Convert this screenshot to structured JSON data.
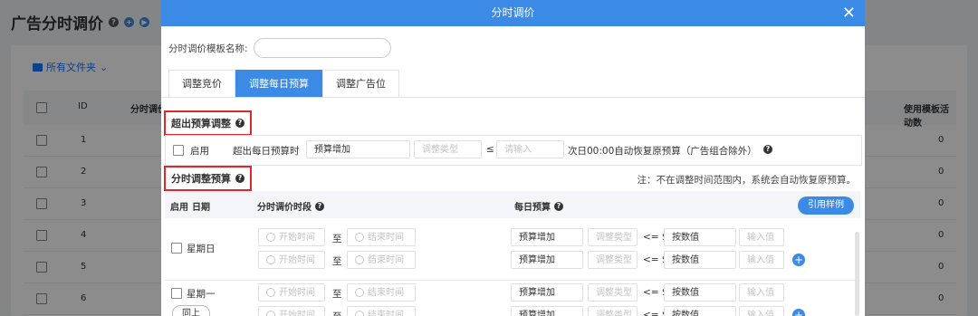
{
  "background": {
    "page_title": "广告分时调价",
    "folder_label": "所有文件夹",
    "columns": {
      "id": "ID",
      "name": "分时调价模",
      "campaigns": "使用模板活动数"
    },
    "rows": [
      {
        "id": "1",
        "count": "0"
      },
      {
        "id": "2",
        "count": "0"
      },
      {
        "id": "3",
        "count": "0"
      },
      {
        "id": "4",
        "count": "0"
      },
      {
        "id": "5",
        "count": "0"
      },
      {
        "id": "6",
        "count": "0"
      }
    ]
  },
  "modal": {
    "title": "分时调价",
    "name_label": "分时调价模板名称:",
    "tabs": [
      "调整竞价",
      "调整每日预算",
      "调整广告位"
    ],
    "active_tab": "调整每日预算",
    "section1": {
      "title": "超出预算调整",
      "enable_label": "启用",
      "when_label": "超出每日预算时",
      "adjust_select": "预算增加",
      "adjust_type_ph": "调整类型",
      "le_sign": "≤",
      "amount_ph": "请输入",
      "restore_text": "次日00:00自动恢复原预算（广告组合除外）"
    },
    "section2": {
      "title": "分时调整预算",
      "note": "注：不在调整时间范围内，系统会自动恢复原预算。",
      "col_enable": "启用",
      "col_date": "日期",
      "col_period": "分时调价时段",
      "col_budget": "每日预算",
      "example_button": "引用样例",
      "start_ph": "开始时间",
      "end_ph": "结束时间",
      "to_label": "至",
      "budget_select": "预算增加",
      "type_ph": "调整类型",
      "le_text": "<= $",
      "value_select": "按数值",
      "value_ph": "输入值",
      "copy_button": "同上",
      "days": [
        {
          "name": "星期日"
        },
        {
          "name": "星期一"
        }
      ]
    }
  }
}
